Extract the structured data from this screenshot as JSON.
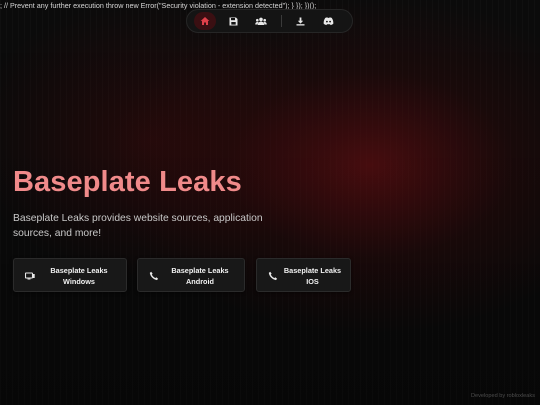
{
  "leaked_script_text": "; // Prevent any further execution throw new Error(\"Security violation - extension detected\"); } }); })();",
  "nav": {
    "items": [
      {
        "icon": "home-icon",
        "active": true
      },
      {
        "icon": "save-icon",
        "active": false
      },
      {
        "icon": "users-icon",
        "active": false
      },
      {
        "icon": "download-icon",
        "active": false
      },
      {
        "icon": "discord-icon",
        "active": false
      }
    ]
  },
  "hero": {
    "title": "Baseplate Leaks",
    "description": "Baseplate Leaks provides website sources, application sources, and more!"
  },
  "downloads": [
    {
      "icon": "monitor-icon",
      "line1": "Baseplate Leaks",
      "line2": "Windows"
    },
    {
      "icon": "phone-icon",
      "line1": "Baseplate Leaks",
      "line2": "Android"
    },
    {
      "icon": "phone-icon",
      "line1": "Baseplate Leaks",
      "line2": "IOS"
    }
  ],
  "footer": {
    "credit": "Developed by robloxleaks"
  },
  "colors": {
    "accent": "#f08a8a",
    "active_nav": "#e0404a",
    "background": "#0b0b0b"
  }
}
